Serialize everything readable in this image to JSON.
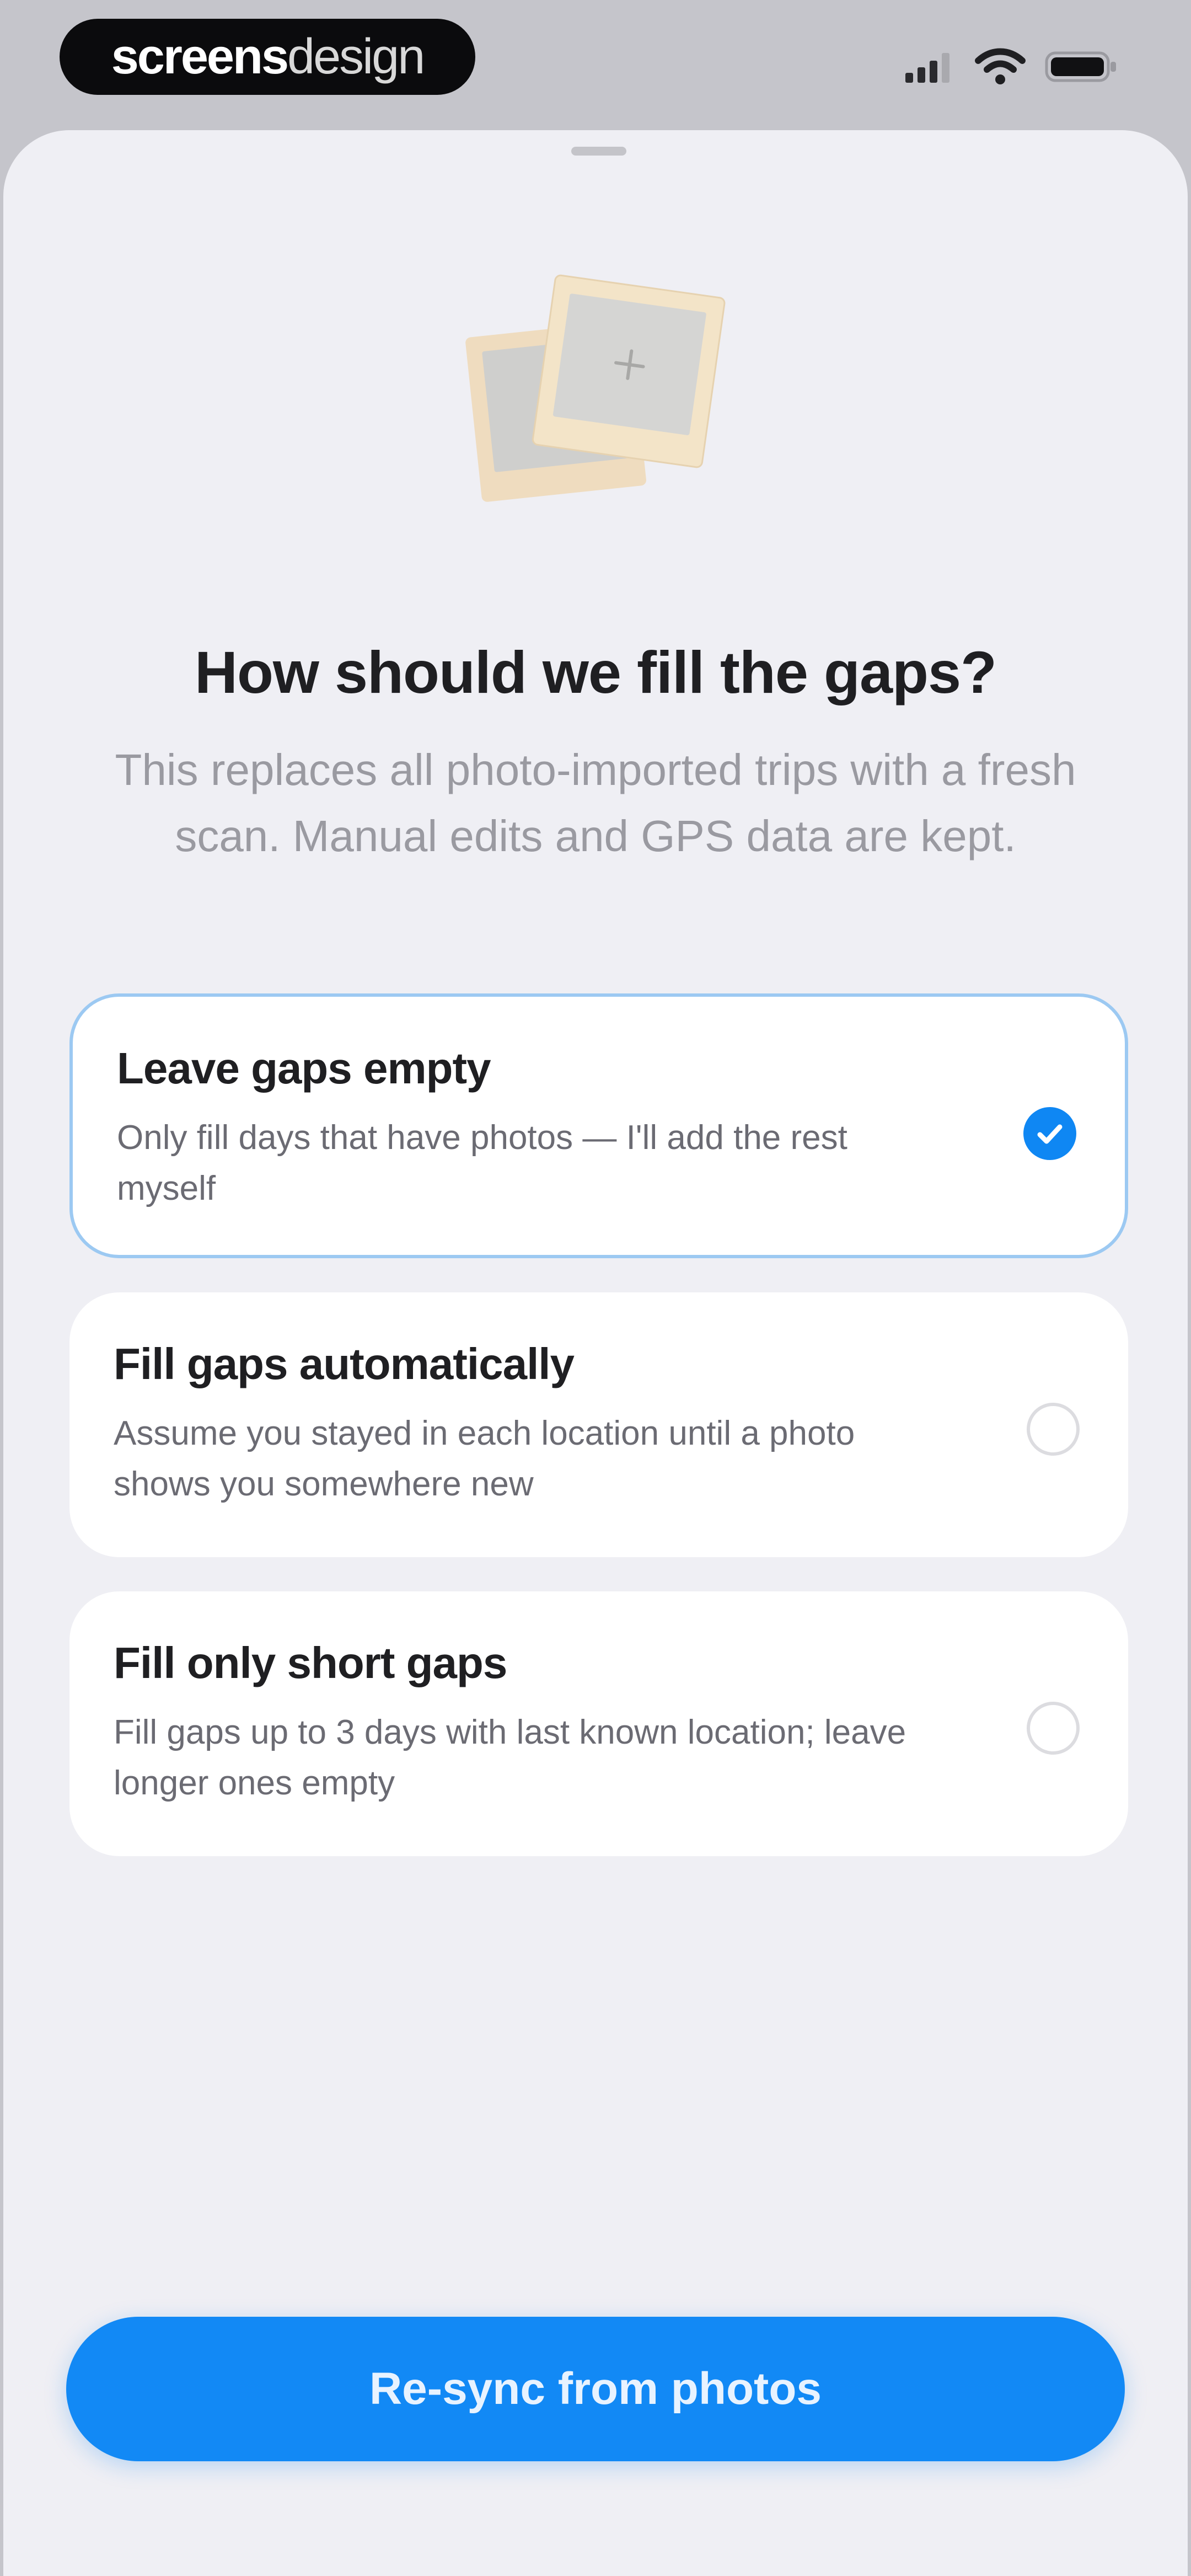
{
  "status_bar": {
    "brand_part1": "screens",
    "brand_part2": "design",
    "icons": [
      "cellular-signal-icon",
      "wifi-icon",
      "battery-icon"
    ]
  },
  "sheet": {
    "title": "How should we fill the gaps?",
    "subtitle": "This replaces all photo-imported trips with a fresh scan. Manual edits and GPS data are kept.",
    "hero_icon": "photo-stack-icon",
    "options": [
      {
        "title": "Leave gaps empty",
        "description": "Only fill days that have photos — I'll add the rest myself",
        "selected": true
      },
      {
        "title": "Fill gaps automatically",
        "description": "Assume you stayed in each location until a photo shows you somewhere new",
        "selected": false
      },
      {
        "title": "Fill only short gaps",
        "description": "Fill gaps up to 3 days with last known location; leave longer ones empty",
        "selected": false
      }
    ],
    "cta_label": "Re-sync from photos"
  },
  "colors": {
    "accent": "#1289f5",
    "sheet_background": "#efeff4",
    "selected_border": "#9cc9f2",
    "photo_frame": "#f3e4c8"
  }
}
